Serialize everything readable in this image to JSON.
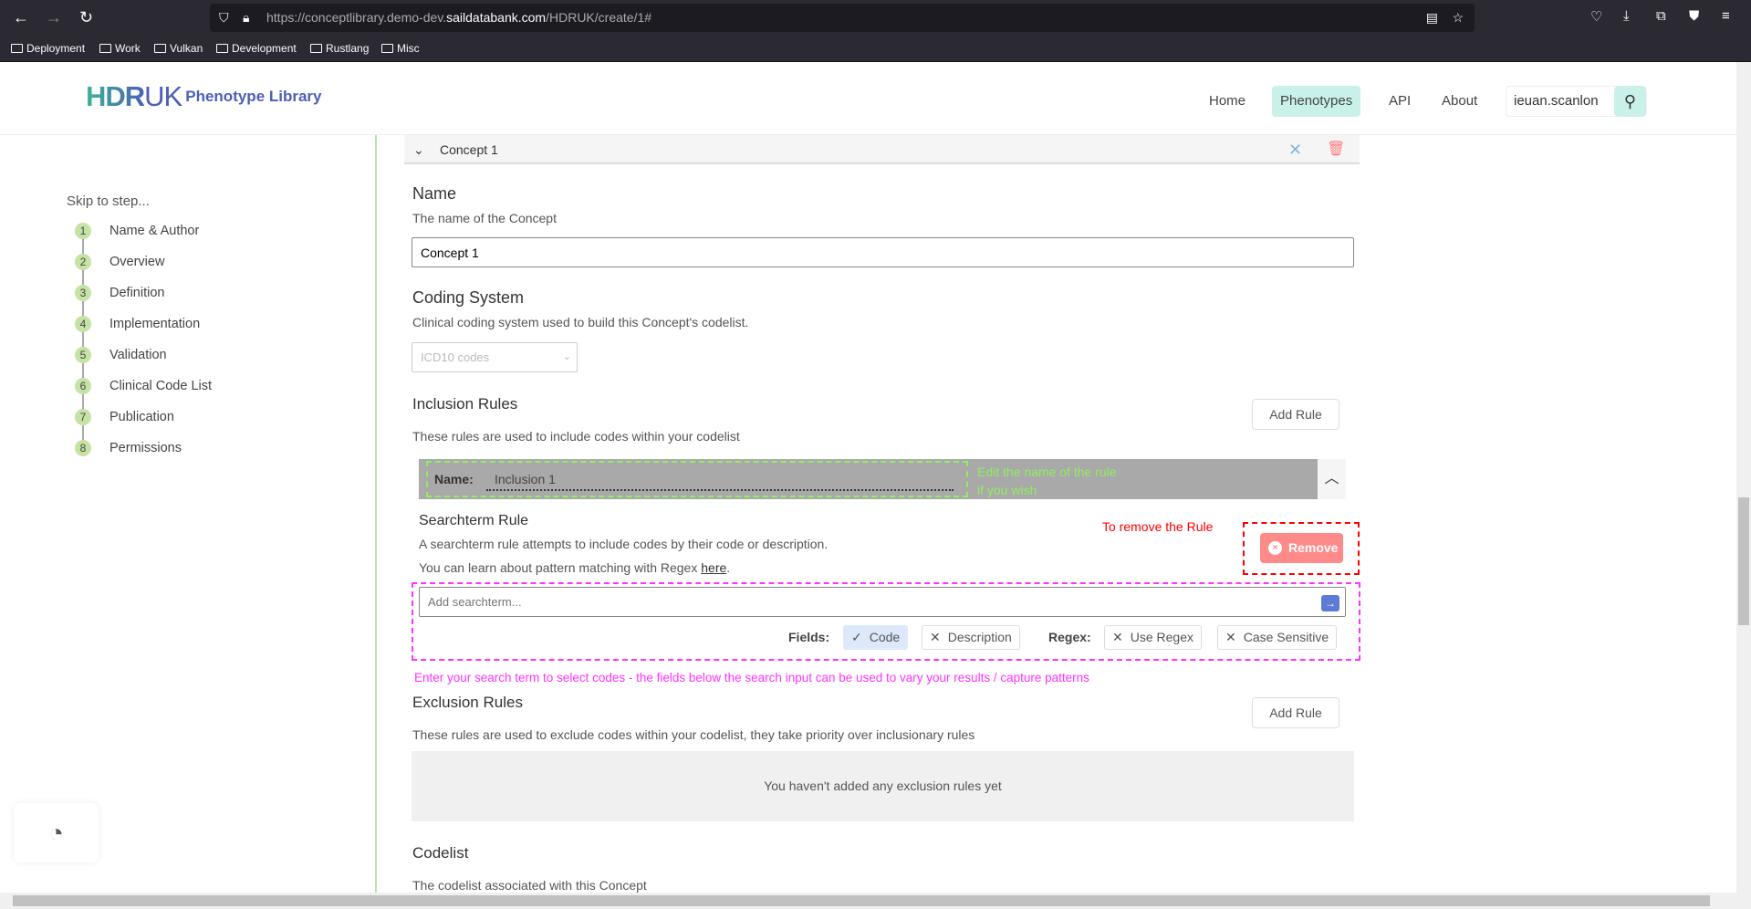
{
  "browser": {
    "url_prefix": "https://conceptlibrary.demo-dev.",
    "url_domain": "saildatabank.com",
    "url_suffix": "/HDRUK/create/1#",
    "bookmarks": [
      "Deployment",
      "Work",
      "Vulkan",
      "Development",
      "Rustlang",
      "Misc"
    ]
  },
  "header": {
    "logo_hdr": "HDR",
    "logo_uk": "UK",
    "logo_text": "Phenotype Library",
    "nav": [
      "Home",
      "Phenotypes",
      "API",
      "About"
    ],
    "active_nav": "Phenotypes",
    "user": "ieuan.scanlon"
  },
  "sidebar": {
    "title": "Skip to step...",
    "steps": [
      {
        "n": "1",
        "label": "Name & Author"
      },
      {
        "n": "2",
        "label": "Overview"
      },
      {
        "n": "3",
        "label": "Definition"
      },
      {
        "n": "4",
        "label": "Implementation"
      },
      {
        "n": "5",
        "label": "Validation"
      },
      {
        "n": "6",
        "label": "Clinical Code List"
      },
      {
        "n": "7",
        "label": "Publication"
      },
      {
        "n": "8",
        "label": "Permissions"
      }
    ]
  },
  "concept": {
    "title": "Concept 1",
    "name": {
      "heading": "Name",
      "desc": "The name of the Concept",
      "value": "Concept 1"
    },
    "coding": {
      "heading": "Coding System",
      "desc": "Clinical coding system used to build this Concept's codelist.",
      "selected": "ICD10 codes"
    },
    "inclusion": {
      "heading": "Inclusion Rules",
      "desc": "These rules are used to include codes within your codelist",
      "add_label": "Add Rule",
      "rule": {
        "name_label": "Name:",
        "name_value": "Inclusion 1",
        "heading": "Searchterm Rule",
        "desc1": "A searchterm rule attempts to include codes by their code or description.",
        "desc2_prefix": "You can learn about pattern matching with Regex ",
        "desc2_link": "here",
        "desc2_suffix": ".",
        "remove_label": "Remove",
        "search_placeholder": "Add searchterm...",
        "fields_label": "Fields:",
        "regex_label": "Regex:",
        "chips": [
          {
            "label": "Code",
            "on": true
          },
          {
            "label": "Description",
            "on": false
          },
          {
            "label": "Use Regex",
            "on": false
          },
          {
            "label": "Case Sensitive",
            "on": false
          }
        ]
      }
    },
    "exclusion": {
      "heading": "Exclusion Rules",
      "desc": "These rules are used to exclude codes within your codelist, they take priority over inclusionary rules",
      "add_label": "Add Rule",
      "empty": "You haven't added any exclusion rules yet"
    },
    "codelist": {
      "heading": "Codelist",
      "desc": "The codelist associated with this Concept"
    }
  },
  "annotations": {
    "name_hint_1": "Edit the name of the rule",
    "name_hint_2": "if you wish",
    "remove_hint": "To remove the Rule",
    "search_hint": "Enter your search term to select codes - the fields below the search input can be used to vary your results / capture patterns"
  },
  "colors": {
    "accent": "#c9f1ea",
    "remove": "#ff8a8a",
    "annotation_green": "#90ee60",
    "annotation_red": "#ff0000",
    "annotation_magenta": "#ff33ff"
  }
}
